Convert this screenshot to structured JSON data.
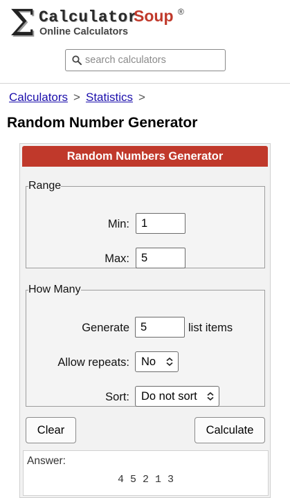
{
  "brand": {
    "sigma": "Σ",
    "name_part1": "Calculator",
    "name_part2": "Soup",
    "registered": "®",
    "tagline": "Online Calculators",
    "accent": "#c0392b"
  },
  "search": {
    "placeholder": "search calculators",
    "value": "",
    "icon": "search-icon"
  },
  "breadcrumb": {
    "items": [
      "Calculators",
      "Statistics"
    ],
    "separator": ">"
  },
  "page": {
    "title": "Random Number Generator"
  },
  "calculator": {
    "title": "Random Numbers Generator",
    "range": {
      "legend": "Range",
      "min_label": "Min:",
      "min_value": "1",
      "max_label": "Max:",
      "max_value": "5"
    },
    "how_many": {
      "legend": "How Many",
      "generate_label": "Generate",
      "generate_value": "5",
      "generate_suffix": "list items",
      "repeats_label": "Allow repeats:",
      "repeats_value": "No",
      "sort_label": "Sort:",
      "sort_value": "Do not sort"
    },
    "buttons": {
      "clear": "Clear",
      "calculate": "Calculate"
    },
    "answer": {
      "label": "Answer:",
      "value": "4 5 2 1 3"
    }
  }
}
